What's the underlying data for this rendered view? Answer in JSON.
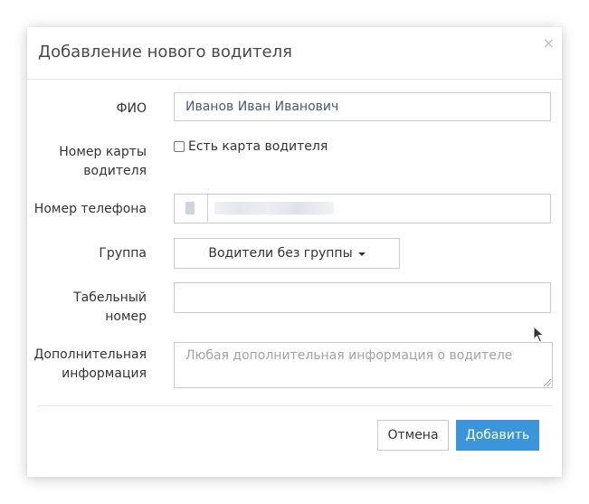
{
  "dialog": {
    "title": "Добавление нового водителя",
    "close_symbol": "×"
  },
  "form": {
    "fio": {
      "label": "ФИО",
      "value": "Иванов Иван Иванович"
    },
    "card": {
      "label_line1": "Номер карты",
      "label_line2": "водителя",
      "checkbox_label": "Есть карта водителя",
      "checked": false
    },
    "phone": {
      "label": "Номер телефона",
      "country_flag_icon": "flag-icon"
    },
    "group": {
      "label": "Группа",
      "selected": "Водители без группы"
    },
    "tabel": {
      "label_line1": "Табельный",
      "label_line2": "номер",
      "value": ""
    },
    "info": {
      "label_line1": "Дополнительная",
      "label_line2": "информация",
      "placeholder": "Любая дополнительная информация о водителе"
    }
  },
  "footer": {
    "cancel_label": "Отмена",
    "submit_label": "Добавить"
  },
  "colors": {
    "primary": "#3a96d8",
    "border": "#c8c8c8",
    "placeholder": "#a3a3a3"
  }
}
